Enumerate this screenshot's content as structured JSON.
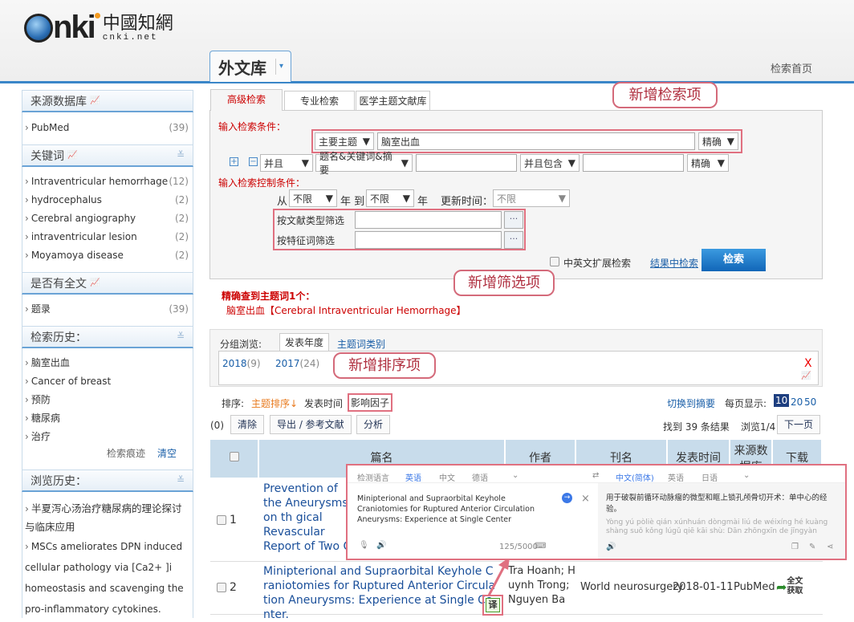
{
  "header": {
    "logo_text": "cnki 中国知网 cnki.net",
    "library_tab": "外文库",
    "home_link": "检索首页"
  },
  "sidebar": {
    "source_db": {
      "title": "来源数据库",
      "items": [
        {
          "label": "PubMed",
          "count": "(39)"
        }
      ]
    },
    "keywords": {
      "title": "关键词",
      "items": [
        {
          "label": "Intraventricular hemorrhage",
          "count": "(12)"
        },
        {
          "label": "hydrocephalus",
          "count": "(2)"
        },
        {
          "label": "Cerebral angiography",
          "count": "(2)"
        },
        {
          "label": "intraventricular lesion",
          "count": "(2)"
        },
        {
          "label": "Moyamoya disease",
          "count": "(2)"
        }
      ]
    },
    "fulltext": {
      "title": "是否有全文",
      "items": [
        {
          "label": "题录",
          "count": "(39)"
        }
      ]
    },
    "history": {
      "title": "检索历史：",
      "items": [
        "脑室出血",
        "Cancer of breast",
        "预防",
        "糖尿病",
        "治疗"
      ],
      "trace": "检索痕迹",
      "clear": "清空"
    },
    "browse": {
      "title": "浏览历史：",
      "items": [
        "半夏泻心汤治疗糖尿病的理论探讨与临床应用",
        "MSCs ameliorates DPN induced cellular pathology via [Ca2+ ]i homeostasis and scavenging the pro-inflammatory cytokines."
      ]
    }
  },
  "search": {
    "tabs": [
      "高级检索",
      "专业检索",
      "医学主题文献库"
    ],
    "input_label": "输入检索条件：",
    "row1": {
      "field": "主要主题",
      "value": "脑室出血",
      "match": "精确"
    },
    "row2": {
      "logic": "并且",
      "field": "题名&关键词&摘要",
      "value": "",
      "logic2": "并且包含",
      "value2": "",
      "match": "精确"
    },
    "control_label": "输入检索控制条件：",
    "from": "从",
    "from_val": "不限",
    "year_to": "年 到",
    "to_val": "不限",
    "year": "年",
    "update_label": "更新时间：",
    "update_val": "不限",
    "filter_doc_type": "按文献类型筛选",
    "filter_feature": "按特征词筛选",
    "dots": "···",
    "expand": "中英文扩展检索",
    "in_results": "结果中检索",
    "search_btn": "检索",
    "callout_search": "新增检索项",
    "callout_filter": "新增筛选项"
  },
  "match_info": {
    "title": "精确查到主题词1个：",
    "term": "脑室出血【Cerebral Intraventricular Hemorrhage】"
  },
  "group": {
    "label": "分组浏览:",
    "tabs": [
      "发表年度",
      "主题词类别"
    ],
    "years": [
      {
        "y": "2018",
        "c": "(9)"
      },
      {
        "y": "2017",
        "c": "(24)"
      }
    ],
    "close": "X",
    "callout_sort": "新增排序项"
  },
  "sort": {
    "label": "排序:",
    "options": [
      "主题排序",
      "发表时间",
      "影响因子"
    ],
    "switch": "切换到摘要",
    "per_page": "每页显示:",
    "sizes": [
      "10",
      "20",
      "50"
    ]
  },
  "actions": {
    "count": "(0)",
    "clear": "清除",
    "export": "导出 / 参考文献",
    "analyze": "分析",
    "found": "找到 39 条结果",
    "browse": "浏览1/4",
    "next": "下一页"
  },
  "table": {
    "headers": [
      "篇名",
      "作者",
      "刊名",
      "发表时间",
      "来源数据库",
      "下载"
    ],
    "rows": [
      {
        "n": "1",
        "title": "Prevention of the Aneurysms on th gical Revascular Report of Two C ure.",
        "author": "",
        "journal": "",
        "date": "",
        "source": "",
        "dl": ""
      },
      {
        "n": "2",
        "title": "Minipterional and Supraorbital Keyhole Craniotomies for Ruptured Anterior Circulation Aneurysms: Experience at Single Center.",
        "author": "Tra Hoanh; Huynh Trong; Nguyen Ba",
        "journal": "World neurosurgery",
        "date": "2018-01-11",
        "source": "PubMed",
        "dl": "全文获取"
      }
    ],
    "translate_icon": "译"
  },
  "translator": {
    "src_langs": [
      "检测语言",
      "英语",
      "中文",
      "德语"
    ],
    "tgt_langs": [
      "中文(简体)",
      "英语",
      "日语"
    ],
    "source_text": "Minipterional and Supraorbital Keyhole Craniotomies for Ruptured Anterior Circulation Aneurysms: Experience at Single Center",
    "char_count": "125/5000",
    "result": "用于破裂前循环动脉瘤的微型和眶上锁孔颅骨切开术：单中心的经验。",
    "pinyin": "Yòng yú pòliè qián xúnhuán dòngmài liú de wéixíng hé kuàng shàng suǒ kǒng lúgǔ qiē kāi shù: Dān zhōngxīn de jīngyàn"
  },
  "colors": {
    "accent": "#3a86c8",
    "highlight": "#e07080",
    "red": "#cc0000",
    "orange": "#e87a1e"
  }
}
